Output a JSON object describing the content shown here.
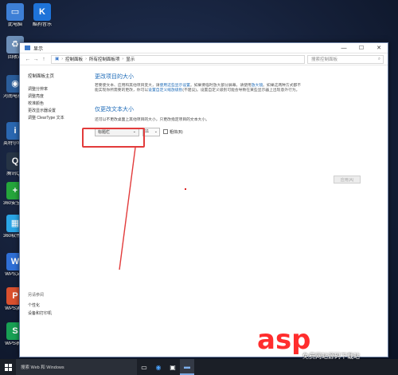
{
  "desktop": {
    "icons": [
      {
        "label": "此电脑",
        "icon": "computer-icon",
        "color": "#3d7fd6",
        "glyph": "▭"
      },
      {
        "label": "酷狗音乐",
        "icon": "kugou-icon",
        "color": "#1e73d9",
        "glyph": "K"
      },
      {
        "label": "回收站",
        "icon": "recycle-bin-icon",
        "color": "#6d8fb8",
        "glyph": "♻"
      },
      {
        "label": "河南电视大学网",
        "icon": "network-icon",
        "color": "#2a5d9b",
        "glyph": "◉"
      },
      {
        "label": "英特尔®视觉",
        "icon": "intel-icon",
        "color": "#2a67b1",
        "glyph": "i"
      },
      {
        "label": "腾讯QQ",
        "icon": "qq-icon",
        "color": "#263445",
        "glyph": "Q"
      },
      {
        "label": "360安全卫士",
        "icon": "360-security-icon",
        "color": "#25a53b",
        "glyph": "+"
      },
      {
        "label": "360软件管家",
        "icon": "360-softmgr-icon",
        "color": "#2aa5e6",
        "glyph": "▦"
      },
      {
        "label": "WPS文字",
        "icon": "wps-writer-icon",
        "color": "#2f6fd6",
        "glyph": "W"
      },
      {
        "label": "WPS演示",
        "icon": "wps-presentation-icon",
        "color": "#d9502e",
        "glyph": "P"
      },
      {
        "label": "WPS表格",
        "icon": "wps-spreadsheet-icon",
        "color": "#18a054",
        "glyph": "S"
      }
    ]
  },
  "window": {
    "title": "显示",
    "controls": {
      "minimize": "—",
      "maximize": "☐",
      "close": "✕"
    },
    "nav": {
      "back": "←",
      "forward": "→",
      "up": "↑"
    },
    "breadcrumb": [
      "控制面板",
      "所有控制面板项",
      "显示"
    ],
    "search_placeholder": "搜索控制面板"
  },
  "sidebar": {
    "home": "控制面板主页",
    "links": [
      "调整分辨率",
      "调整亮度",
      "校准颜色",
      "更改显示器设置",
      "调整 ClearType 文本"
    ],
    "see_also_title": "另请参阅",
    "see_also": [
      "个性化",
      "设备和打印机"
    ]
  },
  "main": {
    "heading1": "更改项目的大小",
    "desc_part1": "若要使文本、应用和其他项目变大，请",
    "desc_link1": "使用这些显示设置",
    "desc_part2": "。如果要临时放大部分屏幕，请使用",
    "desc_link2": "放大镜",
    "desc_part3": "。如果这两种方式都不能实现你所需要的更改，你可以",
    "desc_link3": "设置自定义缩放级别",
    "desc_part4": "(不建议)。设置自定义级别可能会导致在某些显示器上出现意外行为。",
    "heading2": "仅更改文本大小",
    "subdesc": "还可以不更改桌面上其他项目的大小，只更改指定项目的文本大小。",
    "item_select": "标题栏",
    "size_select": "11",
    "bold_label": "粗体(B)",
    "apply_button": "应用(A)"
  },
  "taskbar": {
    "search_text": "搜索 Web 和 Windows"
  },
  "watermark": {
    "text_red": "asp",
    "text_white": "ku",
    "sub": "免费网站源码下载站"
  }
}
